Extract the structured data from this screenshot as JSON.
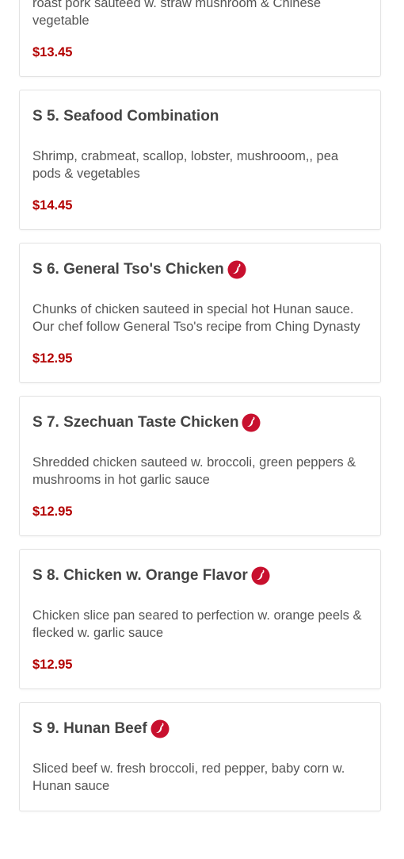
{
  "colors": {
    "price": "#b30000",
    "spicy_icon": "#c8102e"
  },
  "items": [
    {
      "title": "",
      "description": "Combination of crab meat, shrimp, breast of chicken, roast pork sauteed w. straw mushroom & Chinese vegetable",
      "price": "$13.45",
      "spicy": false
    },
    {
      "title": "S 5. Seafood Combination",
      "description": "Shrimp, crabmeat, scallop, lobster, mushrooom,, pea pods & vegetables",
      "price": "$14.45",
      "spicy": false
    },
    {
      "title": "S 6. General Tso's Chicken",
      "description": "Chunks of chicken sauteed in special hot Hunan sauce. Our chef follow General Tso's recipe from Ching Dynasty",
      "price": "$12.95",
      "spicy": true,
      "icon": "hot-pepper-icon"
    },
    {
      "title": "S 7. Szechuan Taste Chicken",
      "description": "Shredded chicken sauteed w. broccoli, green peppers & mushrooms in hot garlic sauce",
      "price": "$12.95",
      "spicy": true,
      "icon": "hot-pepper-icon"
    },
    {
      "title": "S 8. Chicken w. Orange Flavor",
      "description": "Chicken slice pan seared to perfection w. orange peels & flecked w. garlic sauce",
      "price": "$12.95",
      "spicy": true,
      "icon": "hot-pepper-icon"
    },
    {
      "title": "S 9. Hunan Beef",
      "description": "Sliced beef w. fresh broccoli, red pepper, baby corn w. Hunan sauce",
      "price": "",
      "spicy": true,
      "icon": "hot-pepper-icon"
    }
  ]
}
